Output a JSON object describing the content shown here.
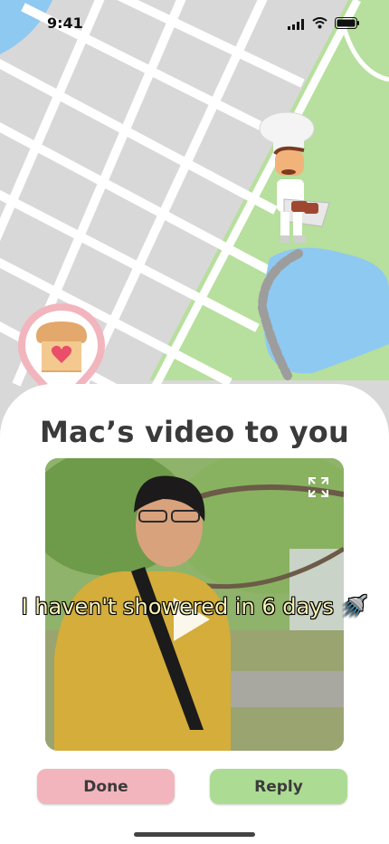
{
  "status_bar": {
    "time": "9:41"
  },
  "sheet": {
    "title": "Mac’s video to you"
  },
  "video": {
    "caption": "I haven't showered in 6 days 🚿"
  },
  "actions": {
    "done_label": "Done",
    "reply_label": "Reply"
  },
  "colors": {
    "done": "#f2b5bd",
    "reply": "#acdc93",
    "park": "#b7df9d",
    "water": "#8ec9f1",
    "pin": "#f2b5bd"
  },
  "icons": [
    "wifi-icon",
    "signal-icon",
    "battery-icon",
    "bread-heart-icon",
    "expand-icon",
    "play-icon",
    "baker-avatar"
  ]
}
